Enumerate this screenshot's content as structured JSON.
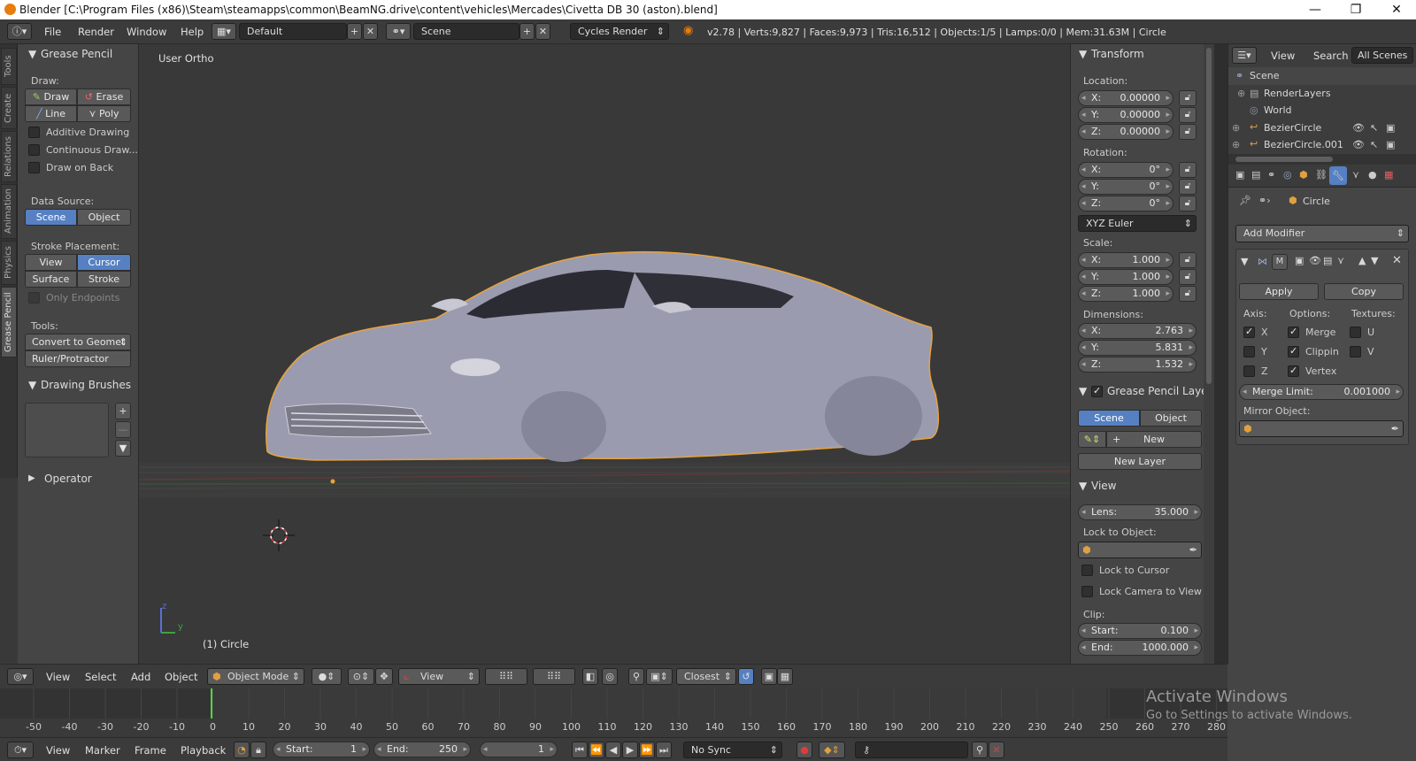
{
  "title_bar": {
    "title": "Blender [C:\\Program Files (x86)\\Steam\\steamapps\\common\\BeamNG.drive\\content\\vehicles\\Mercades\\Civetta DB 30 (aston).blend]",
    "minimize": "—",
    "maximize": "❐",
    "close": "✕"
  },
  "top_menu": {
    "file": "File",
    "render": "Render",
    "window": "Window",
    "help": "Help",
    "layout": "Default",
    "scene": "Scene",
    "engine": "Cycles Render",
    "stats": "v2.78 | Verts:9,827 | Faces:9,973 | Tris:16,512 | Objects:1/5 | Lamps:0/0 | Mem:31.63M | Circle"
  },
  "left_tabs": [
    "Tools",
    "Create",
    "Relations",
    "Animation",
    "Physics",
    "Grease Pencil"
  ],
  "tool_panel": {
    "header": "Grease Pencil",
    "draw_label": "Draw:",
    "draw": "Draw",
    "erase": "Erase",
    "line": "Line",
    "poly": "Poly",
    "additive": "Additive Drawing",
    "continuous": "Continuous Draw...",
    "draw_on_back": "Draw on Back",
    "data_source": "Data Source:",
    "scene": "Scene",
    "object": "Object",
    "stroke_placement": "Stroke Placement:",
    "view": "View",
    "cursor": "Cursor",
    "surface": "Surface",
    "stroke": "Stroke",
    "only_endpoints": "Only Endpoints",
    "tools": "Tools:",
    "convert": "Convert to Geomet",
    "ruler": "Ruler/Protractor",
    "brushes": "Drawing Brushes",
    "operator": "Operator"
  },
  "viewport": {
    "view_label": "User Ortho",
    "object_label": "(1) Circle",
    "axis_z": "z",
    "axis_y": "y"
  },
  "transform_panel": {
    "header": "Transform",
    "location": "Location:",
    "loc": [
      {
        "k": "X:",
        "v": "0.00000"
      },
      {
        "k": "Y:",
        "v": "0.00000"
      },
      {
        "k": "Z:",
        "v": "0.00000"
      }
    ],
    "rotation": "Rotation:",
    "rot": [
      {
        "k": "X:",
        "v": "0°"
      },
      {
        "k": "Y:",
        "v": "0°"
      },
      {
        "k": "Z:",
        "v": "0°"
      }
    ],
    "rotation_mode": "XYZ Euler",
    "scale": "Scale:",
    "scl": [
      {
        "k": "X:",
        "v": "1.000"
      },
      {
        "k": "Y:",
        "v": "1.000"
      },
      {
        "k": "Z:",
        "v": "1.000"
      }
    ],
    "dimensions": "Dimensions:",
    "dim": [
      {
        "k": "X:",
        "v": "2.763"
      },
      {
        "k": "Y:",
        "v": "5.831"
      },
      {
        "k": "Z:",
        "v": "1.532"
      }
    ],
    "gp_layers": "Grease Pencil Layers",
    "gp_scene": "Scene",
    "gp_object": "Object",
    "gp_new": "New",
    "gp_new_layer": "New Layer",
    "view_header": "View",
    "lens_k": "Lens:",
    "lens_v": "35.000",
    "lock_obj": "Lock to Object:",
    "lock_cursor": "Lock to Cursor",
    "lock_camera": "Lock Camera to View",
    "clip": "Clip:",
    "clip_start_k": "Start:",
    "clip_start_v": "0.100",
    "clip_end_k": "End:",
    "clip_end_v": "1000.000"
  },
  "outliner": {
    "view": "View",
    "search": "Search",
    "all_scenes": "All Scenes",
    "items": [
      "Scene",
      "RenderLayers",
      "World",
      "BezierCircle",
      "BezierCircle.001"
    ]
  },
  "properties": {
    "object": "Circle",
    "add_modifier": "Add Modifier",
    "apply": "Apply",
    "copy": "Copy",
    "axis": "Axis:",
    "options": "Options:",
    "textures": "Textures:",
    "x": "X",
    "y": "Y",
    "z": "Z",
    "merge": "Merge",
    "clipping": "Clippin",
    "vertex": "Vertex",
    "u": "U",
    "v": "V",
    "merge_limit_k": "Merge Limit:",
    "merge_limit_v": "0.001000",
    "mirror_object": "Mirror Object:"
  },
  "view_header": {
    "view": "View",
    "select": "Select",
    "add": "Add",
    "object": "Object",
    "mode": "Object Mode",
    "orientation": "View",
    "snap": "Closest"
  },
  "timeline": {
    "ticks": [
      "-50",
      "-40",
      "-30",
      "-20",
      "-10",
      "0",
      "10",
      "20",
      "30",
      "40",
      "50",
      "60",
      "70",
      "80",
      "90",
      "100",
      "110",
      "120",
      "130",
      "140",
      "150",
      "160",
      "170",
      "180",
      "190",
      "200",
      "210",
      "220",
      "230",
      "240",
      "250",
      "260",
      "270",
      "280"
    ],
    "view": "View",
    "marker": "Marker",
    "frame": "Frame",
    "playback": "Playback",
    "start_k": "Start:",
    "start_v": "1",
    "end_k": "End:",
    "end_v": "250",
    "current": "1",
    "sync": "No Sync"
  },
  "watermark": {
    "line1": "Activate Windows",
    "line2": "Go to Settings to activate Windows."
  },
  "colors": {
    "selection_outline": "#e8a33c",
    "accent": "#5680c2",
    "car_body": "#a0a0b4"
  }
}
